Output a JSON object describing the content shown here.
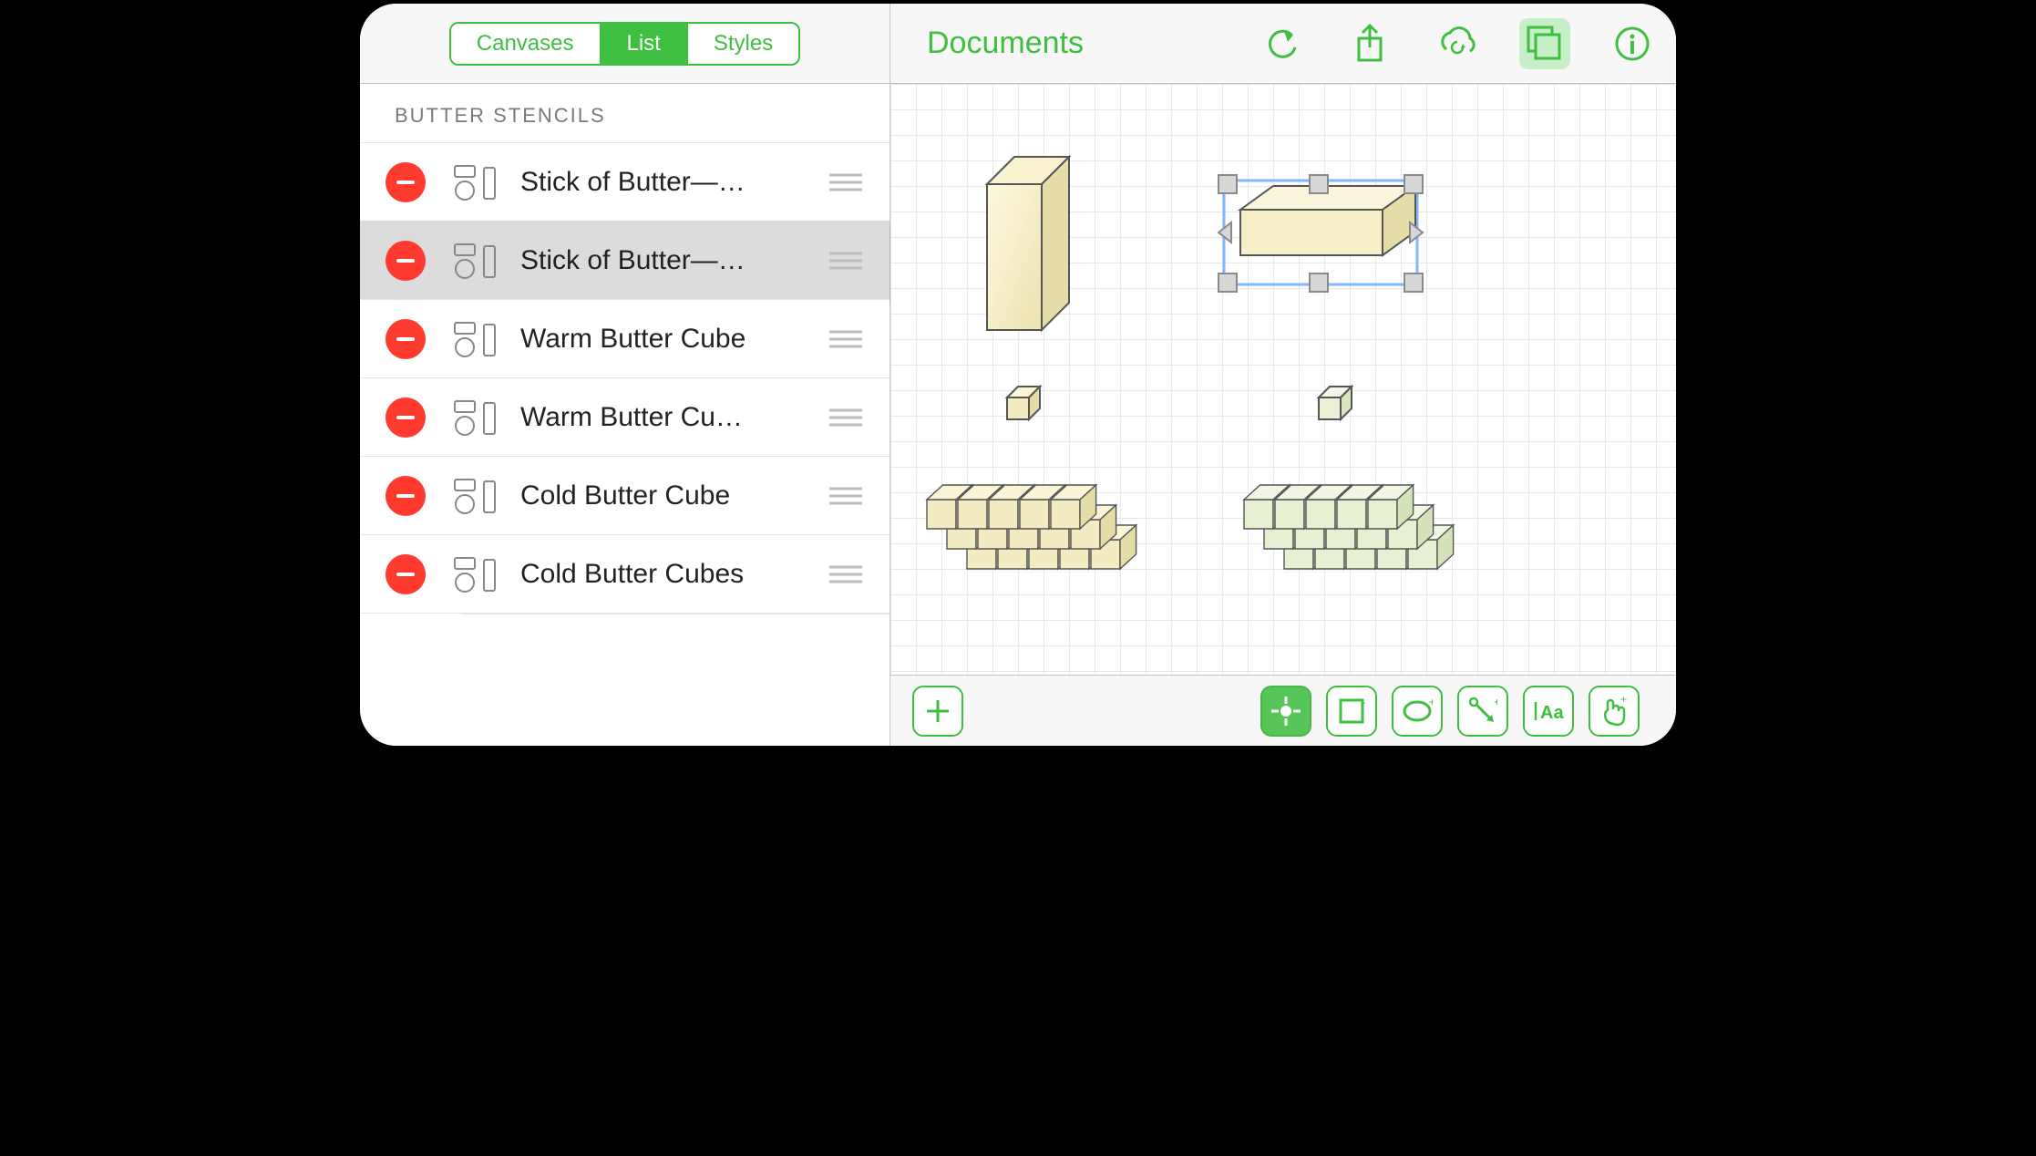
{
  "sidebar": {
    "tabs": [
      "Canvases",
      "List",
      "Styles"
    ],
    "active_tab": 1,
    "section_header": "BUTTER STENCILS",
    "items": [
      {
        "label": "Stick of Butter—…",
        "selected": false
      },
      {
        "label": "Stick of Butter—…",
        "selected": true
      },
      {
        "label": "Warm Butter Cube",
        "selected": false
      },
      {
        "label": "Warm Butter Cu…",
        "selected": false
      },
      {
        "label": "Cold Butter Cube",
        "selected": false
      },
      {
        "label": "Cold Butter Cubes",
        "selected": false
      }
    ]
  },
  "topbar": {
    "title": "Documents",
    "buttons": [
      "undo",
      "share",
      "sync",
      "layers",
      "info"
    ],
    "active_button": "layers"
  },
  "bottombar": {
    "left_tool": "add",
    "right_tools": [
      "point",
      "rect",
      "ellipse",
      "line",
      "text",
      "touch"
    ],
    "active_tool": "point"
  },
  "canvas": {
    "shape_count": 6,
    "selected_shape": "stick-horizontal"
  },
  "colors": {
    "accent": "#3fbf3f",
    "delete": "#ff3b30",
    "butter_warm": "#f1ebc2",
    "butter_cold": "#e6efd8"
  }
}
